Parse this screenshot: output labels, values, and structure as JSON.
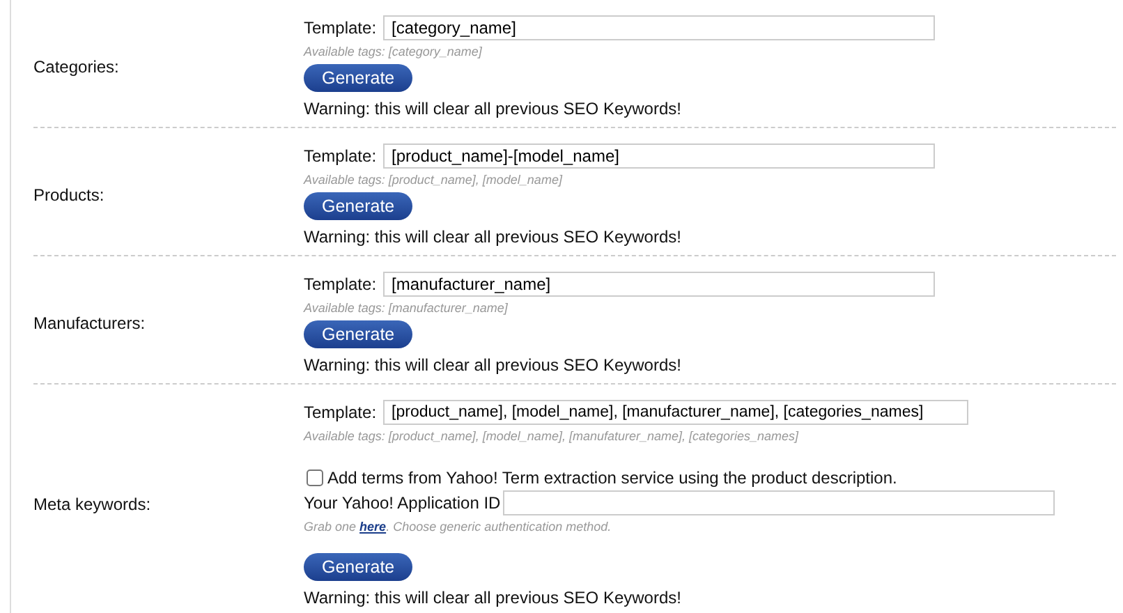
{
  "sections": [
    {
      "label": "Categories:",
      "template_label": "Template:",
      "template_value": "[category_name]",
      "tags": "Available tags: [category_name]",
      "button": "Generate",
      "warning": "Warning: this will clear all previous SEO Keywords!"
    },
    {
      "label": "Products:",
      "template_label": "Template:",
      "template_value": "[product_name]-[model_name]",
      "tags": "Available tags: [product_name], [model_name]",
      "button": "Generate",
      "warning": "Warning: this will clear all previous SEO Keywords!"
    },
    {
      "label": "Manufacturers:",
      "template_label": "Template:",
      "template_value": "[manufacturer_name]",
      "tags": "Available tags: [manufacturer_name]",
      "button": "Generate",
      "warning": "Warning: this will clear all previous SEO Keywords!"
    },
    {
      "label": "Meta keywords:",
      "template_label": "Template:",
      "template_value": "[product_name], [model_name], [manufacturer_name], [categories_names]",
      "tags": "Available tags: [product_name], [model_name], [manufaturer_name], [categories_names]",
      "yahoo": {
        "checkbox_label": "Add terms from Yahoo! Term extraction service using the product description.",
        "checked": false,
        "id_label": "Your Yahoo! Application ID",
        "hint_before": "Grab one",
        "hint_link": "here",
        "hint_after": ". Choose generic authentication method."
      },
      "button": "Generate",
      "warning": "Warning: this will clear all previous SEO Keywords!"
    }
  ]
}
